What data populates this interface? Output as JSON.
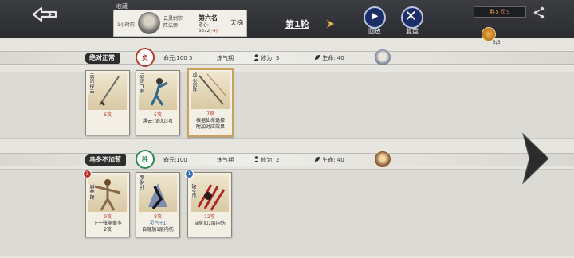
{
  "header": {
    "collect_label": "收藏",
    "rank_card": {
      "time": "1小时前",
      "name_line1": "云灵剑宗",
      "name_line2": "阵法师",
      "rank": "第六名",
      "dao_label": "道心:",
      "dao_value": "6672",
      "dao_delta": "(-4)",
      "ladder": "天梯"
    },
    "round": "第1轮",
    "replay_label": "回放",
    "review_label": "复盘",
    "score_win": "胜5",
    "score_lose": "负9",
    "coin_count": "3/3"
  },
  "players": [
    {
      "name": "绝对正常",
      "result": "负",
      "result_type": "lose",
      "life_label": "命元:",
      "life": "100",
      "life_extra": "3",
      "realm": "炼气期",
      "cultivation_label": "修为:",
      "cultivation": "3",
      "hp_label": "生命:",
      "hp": "40",
      "cards": [
        {
          "title": "云剑·探云",
          "lines": [
            [
              "6攻",
              "atk"
            ]
          ],
          "level": "",
          "frame": "normal",
          "art": "sword"
        },
        {
          "title": "云剑·飞刺",
          "lines": [
            [
              "5攻",
              "atk"
            ],
            [
              "趣云: 追加3攻",
              ""
            ]
          ],
          "level": "",
          "frame": "normal",
          "art": "figure"
        },
        {
          "title": "虚心剑阵",
          "lines": [
            [
              "7攻",
              "atk"
            ],
            [
              "根据仙命选择",
              ""
            ],
            [
              "附加对应效果",
              ""
            ]
          ],
          "level": "",
          "frame": "gold",
          "art": "sword2"
        }
      ]
    },
    {
      "name": "乌冬不加葱",
      "result": "胜",
      "result_type": "win",
      "life_label": "命元:",
      "life": "100",
      "life_extra": "",
      "realm": "炼气期",
      "cultivation_label": "修为:",
      "cultivation": "2",
      "hp_label": "生命:",
      "hp": "40",
      "cards": [
        {
          "title": "崩拳·鞭",
          "lines": [
            [
              "9攻",
              "atk"
            ],
            [
              "下一张崩拳多",
              ""
            ],
            [
              "2攻",
              ""
            ]
          ],
          "level": "3",
          "level_color": "red",
          "frame": "normal",
          "art": "monk"
        },
        {
          "title": "罗刹扑",
          "lines": [
            [
              "8攻",
              "atk"
            ],
            [
              "灵气+1",
              "blue"
            ],
            [
              "自身加1层内伤",
              ""
            ]
          ],
          "level": "",
          "frame": "normal",
          "art": "shadow"
        },
        {
          "title": "破空爪",
          "lines": [
            [
              "12攻",
              "atk"
            ],
            [
              "自身加1层内伤",
              ""
            ]
          ],
          "level": "1",
          "level_color": "blue",
          "frame": "normal",
          "art": "claw"
        }
      ]
    }
  ]
}
